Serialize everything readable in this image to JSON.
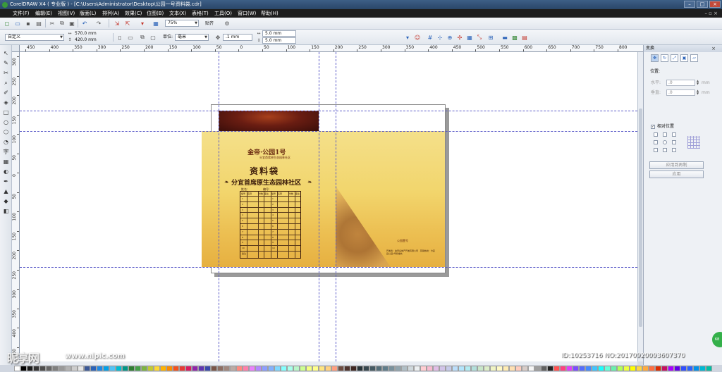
{
  "window": {
    "title": "CorelDRAW X4 ( 专业版 ) - [C:\\Users\\Administrator\\Desktop\\公园一号资料袋.cdr]"
  },
  "menu": [
    "文件(F)",
    "编辑(E)",
    "视图(V)",
    "版面(L)",
    "排列(A)",
    "效果(C)",
    "位图(B)",
    "文本(X)",
    "表格(T)",
    "工具(O)",
    "窗口(W)",
    "帮助(H)"
  ],
  "standard_toolbar": {
    "zoom": "75%",
    "snap_label": "贴齐"
  },
  "property_bar": {
    "paper_preset": "自定义",
    "width": "570.0 mm",
    "height": "420.0 mm",
    "units_label": "单位:",
    "units": "毫米",
    "nudge": ".1 mm",
    "dup_x": "5.0 mm",
    "dup_y": "5.0 mm"
  },
  "rulers": {
    "horizontal": [
      "450",
      "400",
      "350",
      "300",
      "250",
      "200",
      "150",
      "100",
      "50",
      "0",
      "50",
      "100",
      "150",
      "200",
      "250",
      "300",
      "350",
      "400",
      "450",
      "500",
      "550",
      "600",
      "650",
      "700",
      "750",
      "800"
    ],
    "vertical": [
      "300",
      "250",
      "200",
      "150",
      "100",
      "50",
      "0",
      "50",
      "100",
      "150",
      "200",
      "250",
      "300",
      "350",
      "400",
      "450"
    ]
  },
  "envelope": {
    "logo": "金帝·公园1号",
    "logo_sub": "分宜首席原生态园林社区",
    "title": "资料袋",
    "subtitle": "分宜首席原生态园林社区",
    "name_label": "姓名:",
    "number_label": "编号:",
    "table_headers": [
      "编号",
      "名称",
      "份数",
      "备注",
      "编号",
      "名称",
      "份数",
      "备注"
    ],
    "rows_left": [
      "1",
      "2",
      "3",
      "4",
      "5",
      "6",
      "7",
      "8",
      "9",
      "10"
    ],
    "rows_right": [
      "1",
      "2",
      "3",
      "4",
      "5",
      "6",
      "7",
      "8",
      "9",
      "10"
    ],
    "remark": "备注",
    "bottom_logo": "公园壹号",
    "bottom_text": "开发商：金帝房地产开发有限公司 · 营销热线：分宜县公园1号售楼处"
  },
  "docker": {
    "title": "变换",
    "position_label": "位置:",
    "h_label": "水平:",
    "h_value": ".0",
    "v_label": "垂直:",
    "v_value": ".0",
    "unit": "mm",
    "relative_label": "相对位置",
    "apply_dup_label": "应用到再制",
    "apply_label": "应用"
  },
  "watermark": {
    "site": "昵享网",
    "url": "www.nipic.com",
    "id": "ID:10253716 NO:20170920093607370"
  },
  "badge": "68",
  "colors": {
    "title_bar": "#2a4668",
    "menu_bar": "#1e1e1e",
    "envelope_gold": "#f2d56c",
    "envelope_brown": "#6a1d12",
    "guide": "#5a5ac8"
  },
  "palette": [
    "#ffffff",
    "#000000",
    "#1a1a1a",
    "#333333",
    "#4d4d4d",
    "#666666",
    "#808080",
    "#999999",
    "#b3b3b3",
    "#cccccc",
    "#e6e6e6",
    "#3b5998",
    "#2a62b8",
    "#1e88e5",
    "#00a0e9",
    "#4fc3f7",
    "#00bcd4",
    "#009688",
    "#2e7d32",
    "#43a047",
    "#7cb342",
    "#c0ca33",
    "#fdd835",
    "#ffb300",
    "#fb8c00",
    "#f4511e",
    "#e53935",
    "#d81b60",
    "#8e24aa",
    "#5e35b1",
    "#3949ab",
    "#795548",
    "#8d6e63",
    "#a1887f",
    "#bcaaa4",
    "#ff8a80",
    "#ff80ab",
    "#ea80fc",
    "#b388ff",
    "#8c9eff",
    "#82b1ff",
    "#80d8ff",
    "#84ffff",
    "#a7ffeb",
    "#b9f6ca",
    "#ccff90",
    "#f4ff81",
    "#ffff8d",
    "#ffe57f",
    "#ffd180",
    "#ff9e80",
    "#6d4c41",
    "#4e342e",
    "#3e2723",
    "#263238",
    "#37474f",
    "#455a64",
    "#546e7a",
    "#607d8b",
    "#78909c",
    "#90a4ae",
    "#b0bec5",
    "#cfd8dc",
    "#eceff1",
    "#ffcdd2",
    "#f8bbd0",
    "#e1bee7",
    "#d1c4e9",
    "#c5cae9",
    "#bbdefb",
    "#b3e5fc",
    "#b2ebf2",
    "#b2dfdb",
    "#c8e6c9",
    "#dcedc8",
    "#f0f4c3",
    "#fff9c4",
    "#ffecb3",
    "#ffe0b2",
    "#ffccbc",
    "#d7ccc8",
    "#f5f5f5",
    "#9e9e9e",
    "#616161",
    "#212121",
    "#ff5252",
    "#ff4081",
    "#e040fb",
    "#7c4dff",
    "#536dfe",
    "#448aff",
    "#40c4ff",
    "#18ffff",
    "#64ffda",
    "#69f0ae",
    "#b2ff59",
    "#eeff41",
    "#ffff00",
    "#ffd740",
    "#ffab40",
    "#ff6e40",
    "#dd2c00",
    "#c51162",
    "#aa00ff",
    "#6200ea",
    "#304ffe",
    "#2962ff",
    "#0091ea",
    "#00b8d4",
    "#00bfa5"
  ]
}
